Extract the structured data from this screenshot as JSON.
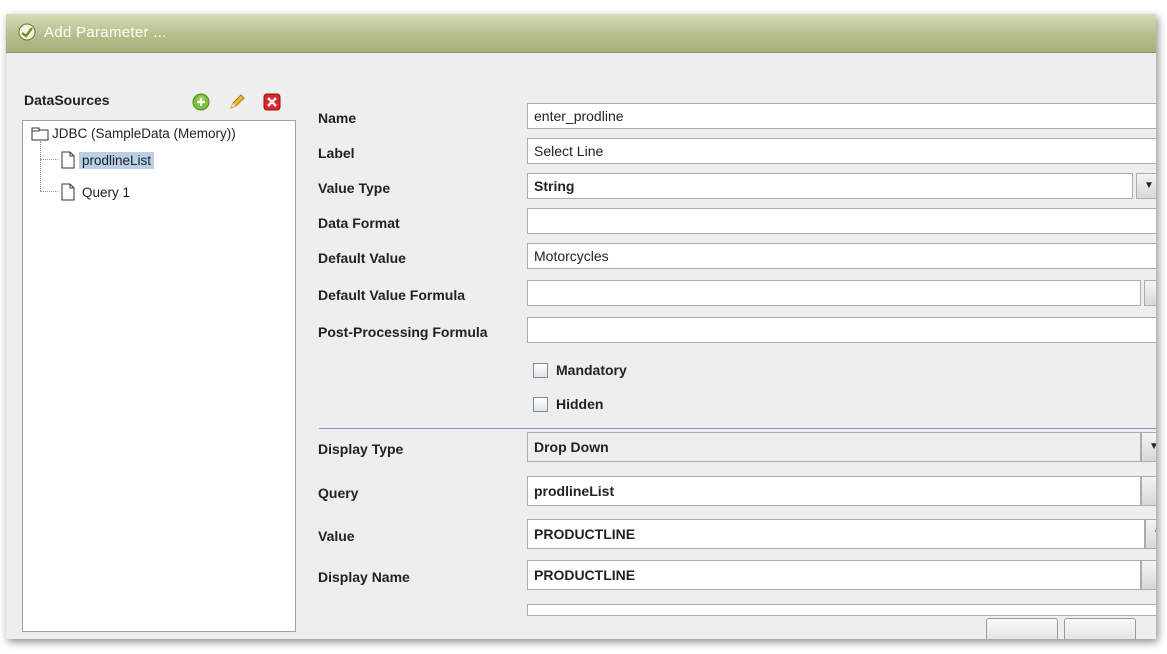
{
  "window": {
    "title": "Add Parameter ..."
  },
  "datasources": {
    "header": "DataSources",
    "tree": {
      "root": "JDBC (SampleData (Memory))",
      "children": [
        "prodlineList",
        "Query 1"
      ],
      "selected_index": 0
    }
  },
  "form": {
    "name": {
      "label": "Name",
      "value": "enter_prodline"
    },
    "label": {
      "label": "Label",
      "value": "Select Line"
    },
    "value_type": {
      "label": "Value Type",
      "value": "String"
    },
    "data_format": {
      "label": "Data Format",
      "value": ""
    },
    "default_value": {
      "label": "Default Value",
      "value": "Motorcycles"
    },
    "default_value_formula": {
      "label": "Default Value Formula",
      "value": ""
    },
    "post_processing_formula": {
      "label": "Post-Processing Formula",
      "value": ""
    },
    "mandatory": {
      "label": "Mandatory",
      "checked": false
    },
    "hidden": {
      "label": "Hidden",
      "checked": false
    },
    "display_type": {
      "label": "Display Type",
      "value": "Drop Down"
    },
    "query": {
      "label": "Query",
      "value": "prodlineList"
    },
    "value": {
      "label": "Value",
      "value": "PRODUCTLINE"
    },
    "display_name": {
      "label": "Display Name",
      "value": "PRODUCTLINE"
    }
  },
  "colors": {
    "titlebar": "#b7be8d",
    "selection": "#b8cfe5",
    "separator": "#7f9db9"
  }
}
